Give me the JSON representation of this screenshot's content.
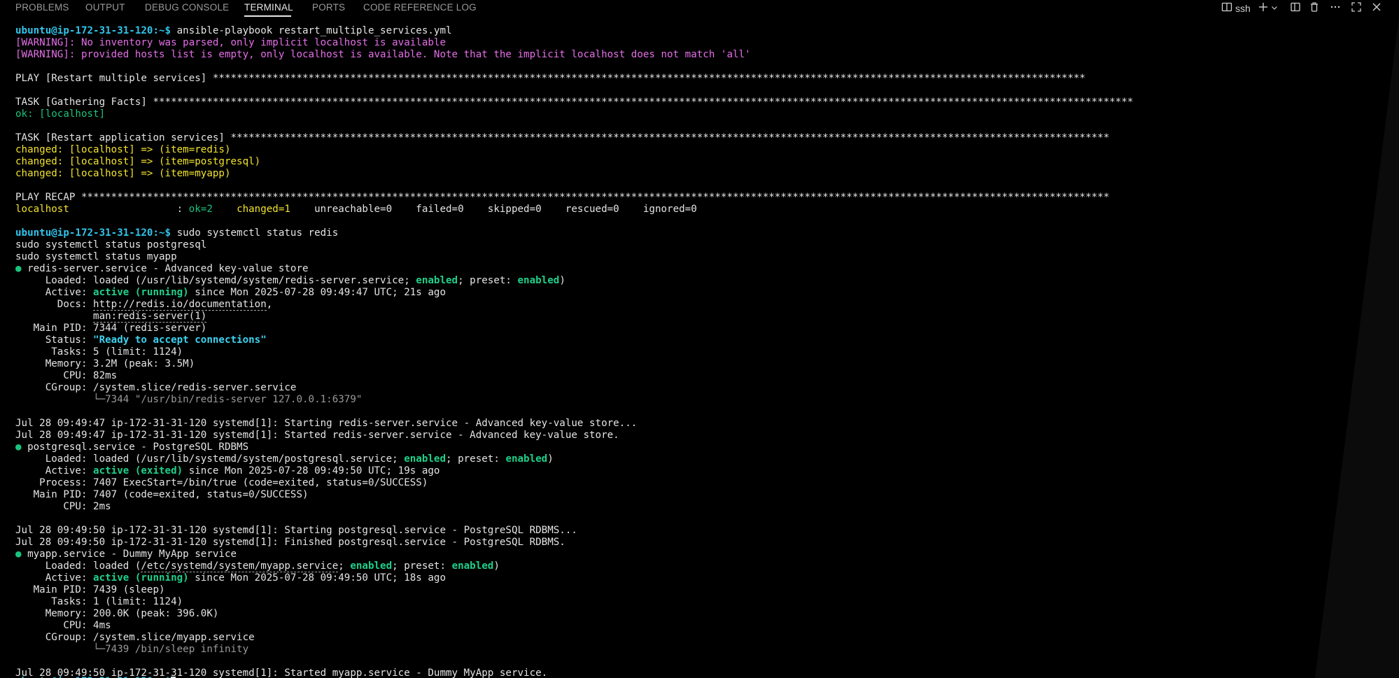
{
  "panel": {
    "tabs": [
      "PROBLEMS",
      "OUTPUT",
      "DEBUG CONSOLE",
      "TERMINAL",
      "PORTS",
      "CODE REFERENCE LOG"
    ],
    "active_tab": "TERMINAL",
    "terminal_name": "ssh"
  },
  "colors": {
    "background": "#000000",
    "prompt": "#31c4ea",
    "warning": "#e56ee8",
    "changed": "#f2e22e",
    "ok": "#19c37d"
  },
  "terminal": {
    "prompt": "ubuntu@ip-172-31-31-120:~$",
    "cmd1": " ansible-playbook restart_multiple_services.yml",
    "warn1": "[WARNING]: No inventory was parsed, only implicit localhost is available",
    "warn2": "[WARNING]: provided hosts list is empty, only localhost is available. Note that the implicit localhost does not match 'all'",
    "play": "PLAY [Restart multiple services] **************************************************************************************************************************************************",
    "task1": "TASK [Gathering Facts] ********************************************************************************************************************************************************************",
    "ok_localhost": "ok: [localhost]",
    "task2": "TASK [Restart application services] ***************************************************************************************************************************************************",
    "changed_redis": "changed: [localhost] => (item=redis)",
    "changed_pg": "changed: [localhost] => (item=postgresql)",
    "changed_myapp": "changed: [localhost] => (item=myapp)",
    "recap": "PLAY RECAP ****************************************************************************************************************************************************************************",
    "recap_host": "localhost                  ",
    "recap_sep": ": ",
    "recap_ok": "ok=2",
    "recap_changed": "changed=1",
    "recap_rest": "    unreachable=0    failed=0    skipped=0    rescued=0    ignored=0",
    "cmd2": " sudo systemctl status redis",
    "cmd2b": "sudo systemctl status postgresql",
    "cmd2c": "sudo systemctl status myapp",
    "redis_head": " redis-server.service - Advanced key-value store",
    "redis_loaded_a": "     Loaded: loaded (/usr/lib/systemd/system/redis-server.service; ",
    "enabled": "enabled",
    "preset": "; preset: ",
    "close_paren": ")",
    "active_label": "     Active: ",
    "active_running": "active (running)",
    "redis_active_rest": " since Mon 2025-07-28 09:49:47 UTC; 21s ago",
    "redis_docs_a": "       Docs: ",
    "redis_docs_url": "http://redis.io/documentation",
    "redis_docs_comma": ",",
    "redis_docs_pad": "             ",
    "redis_docs_man": "man:redis-server(1)",
    "redis_pid": "   Main PID: 7344 (redis-server)",
    "redis_status_a": "     Status: ",
    "redis_status_val": "\"Ready to accept connections\"",
    "redis_tasks": "      Tasks: 5 (limit: 1124)",
    "redis_memory": "     Memory: 3.2M (peak: 3.5M)",
    "redis_cpu": "        CPU: 82ms",
    "redis_cgroup": "     CGroup: /system.slice/redis-server.service",
    "redis_cgroup_pad": "             ",
    "redis_cgroup_proc": "└─7344 \"/usr/bin/redis-server 127.0.0.1:6379\"",
    "redis_log1": "Jul 28 09:49:47 ip-172-31-31-120 systemd[1]: Starting redis-server.service - Advanced key-value store...",
    "redis_log2": "Jul 28 09:49:47 ip-172-31-31-120 systemd[1]: Started redis-server.service - Advanced key-value store.",
    "pg_head": " postgresql.service - PostgreSQL RDBMS",
    "pg_loaded_a": "     Loaded: loaded (/usr/lib/systemd/system/postgresql.service; ",
    "active_exited": "active (exited)",
    "pg_active_rest": " since Mon 2025-07-28 09:49:50 UTC; 19s ago",
    "pg_process": "    Process: 7407 ExecStart=/bin/true (code=exited, status=0/SUCCESS)",
    "pg_pid": "   Main PID: 7407 (code=exited, status=0/SUCCESS)",
    "pg_cpu": "        CPU: 2ms",
    "pg_log1": "Jul 28 09:49:50 ip-172-31-31-120 systemd[1]: Starting postgresql.service - PostgreSQL RDBMS...",
    "pg_log2": "Jul 28 09:49:50 ip-172-31-31-120 systemd[1]: Finished postgresql.service - PostgreSQL RDBMS.",
    "app_head": " myapp.service - Dummy MyApp service",
    "app_loaded_a": "     Loaded: loaded (",
    "app_loaded_path": "/etc/systemd/system/myapp.service",
    "app_loaded_b": "; ",
    "app_active_rest": " since Mon 2025-07-28 09:49:50 UTC; 18s ago",
    "app_pid": "   Main PID: 7439 (sleep)",
    "app_tasks": "      Tasks: 1 (limit: 1124)",
    "app_memory": "     Memory: 200.0K (peak: 396.0K)",
    "app_cpu": "        CPU: 4ms",
    "app_cgroup": "     CGroup: /system.slice/myapp.service",
    "app_cgroup_pad": "             ",
    "app_cgroup_proc": "└─7439 /bin/sleep infinity",
    "app_log1": "Jul 28 09:49:50 ip-172-31-31-120 systemd[1]: Started myapp.service - Dummy MyApp service."
  }
}
